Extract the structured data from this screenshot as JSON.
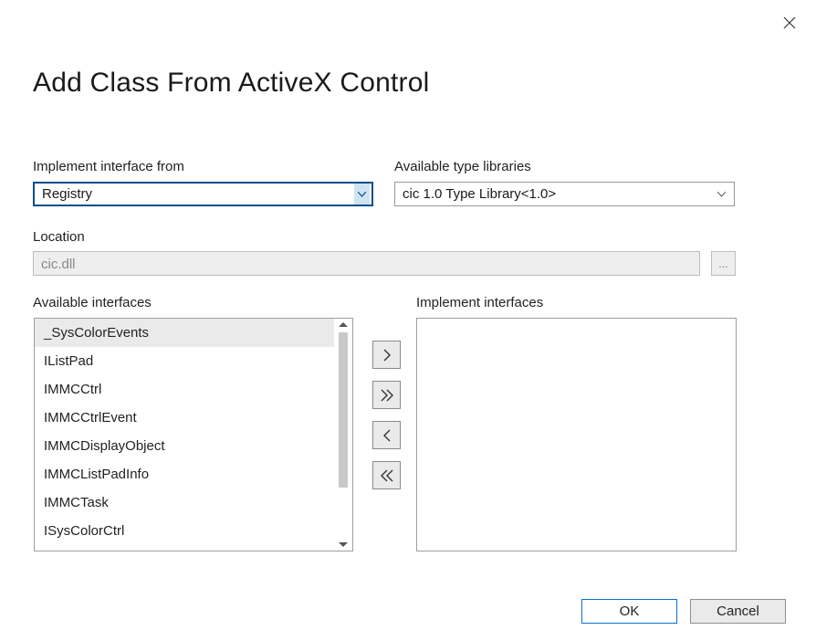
{
  "title": "Add Class From ActiveX Control",
  "labels": {
    "implement_from": "Implement interface from",
    "libraries": "Available type libraries",
    "location": "Location",
    "available_interfaces": "Available interfaces",
    "implement_interfaces": "Implement interfaces"
  },
  "implement_from": {
    "selected": "Registry"
  },
  "libraries": {
    "selected": "cic 1.0 Type Library<1.0>"
  },
  "location": {
    "value": "cic.dll",
    "browse_label": "..."
  },
  "available_interfaces": [
    "_SysColorEvents",
    "IListPad",
    "IMMCCtrl",
    "IMMCCtrlEvent",
    "IMMCDisplayObject",
    "IMMCListPadInfo",
    "IMMCTask",
    "ISysColorCtrl"
  ],
  "implement_interfaces": [],
  "buttons": {
    "ok": "OK",
    "cancel": "Cancel"
  }
}
